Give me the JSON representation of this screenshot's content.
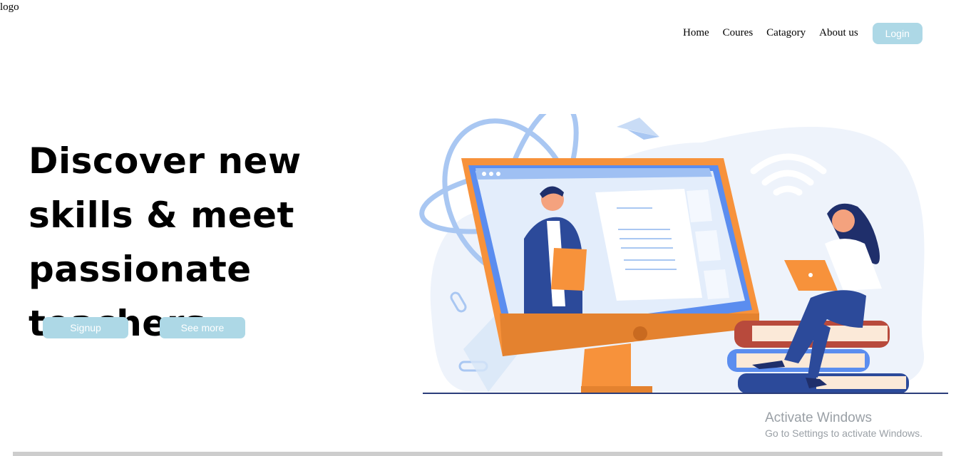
{
  "header": {
    "logo_text": "logo",
    "nav": {
      "home": "Home",
      "courses": "Coures",
      "category": "Catagory",
      "about": "About us",
      "login": "Login"
    }
  },
  "hero": {
    "title": "Discover new skills & meet passionate teachers",
    "signup_label": "Signup",
    "see_more_label": "See more"
  },
  "watermark": {
    "title": "Activate Windows",
    "subtitle": "Go to Settings to activate Windows."
  },
  "colors": {
    "button_bg": "#add8e6",
    "button_text": "#ffffff",
    "accent_orange": "#f7923b",
    "accent_blue": "#5b8def",
    "navy": "#2c3e7a"
  },
  "icons": [
    "wifi-icon",
    "paper-plane-icon",
    "paperclip-icon",
    "globe-icon"
  ]
}
